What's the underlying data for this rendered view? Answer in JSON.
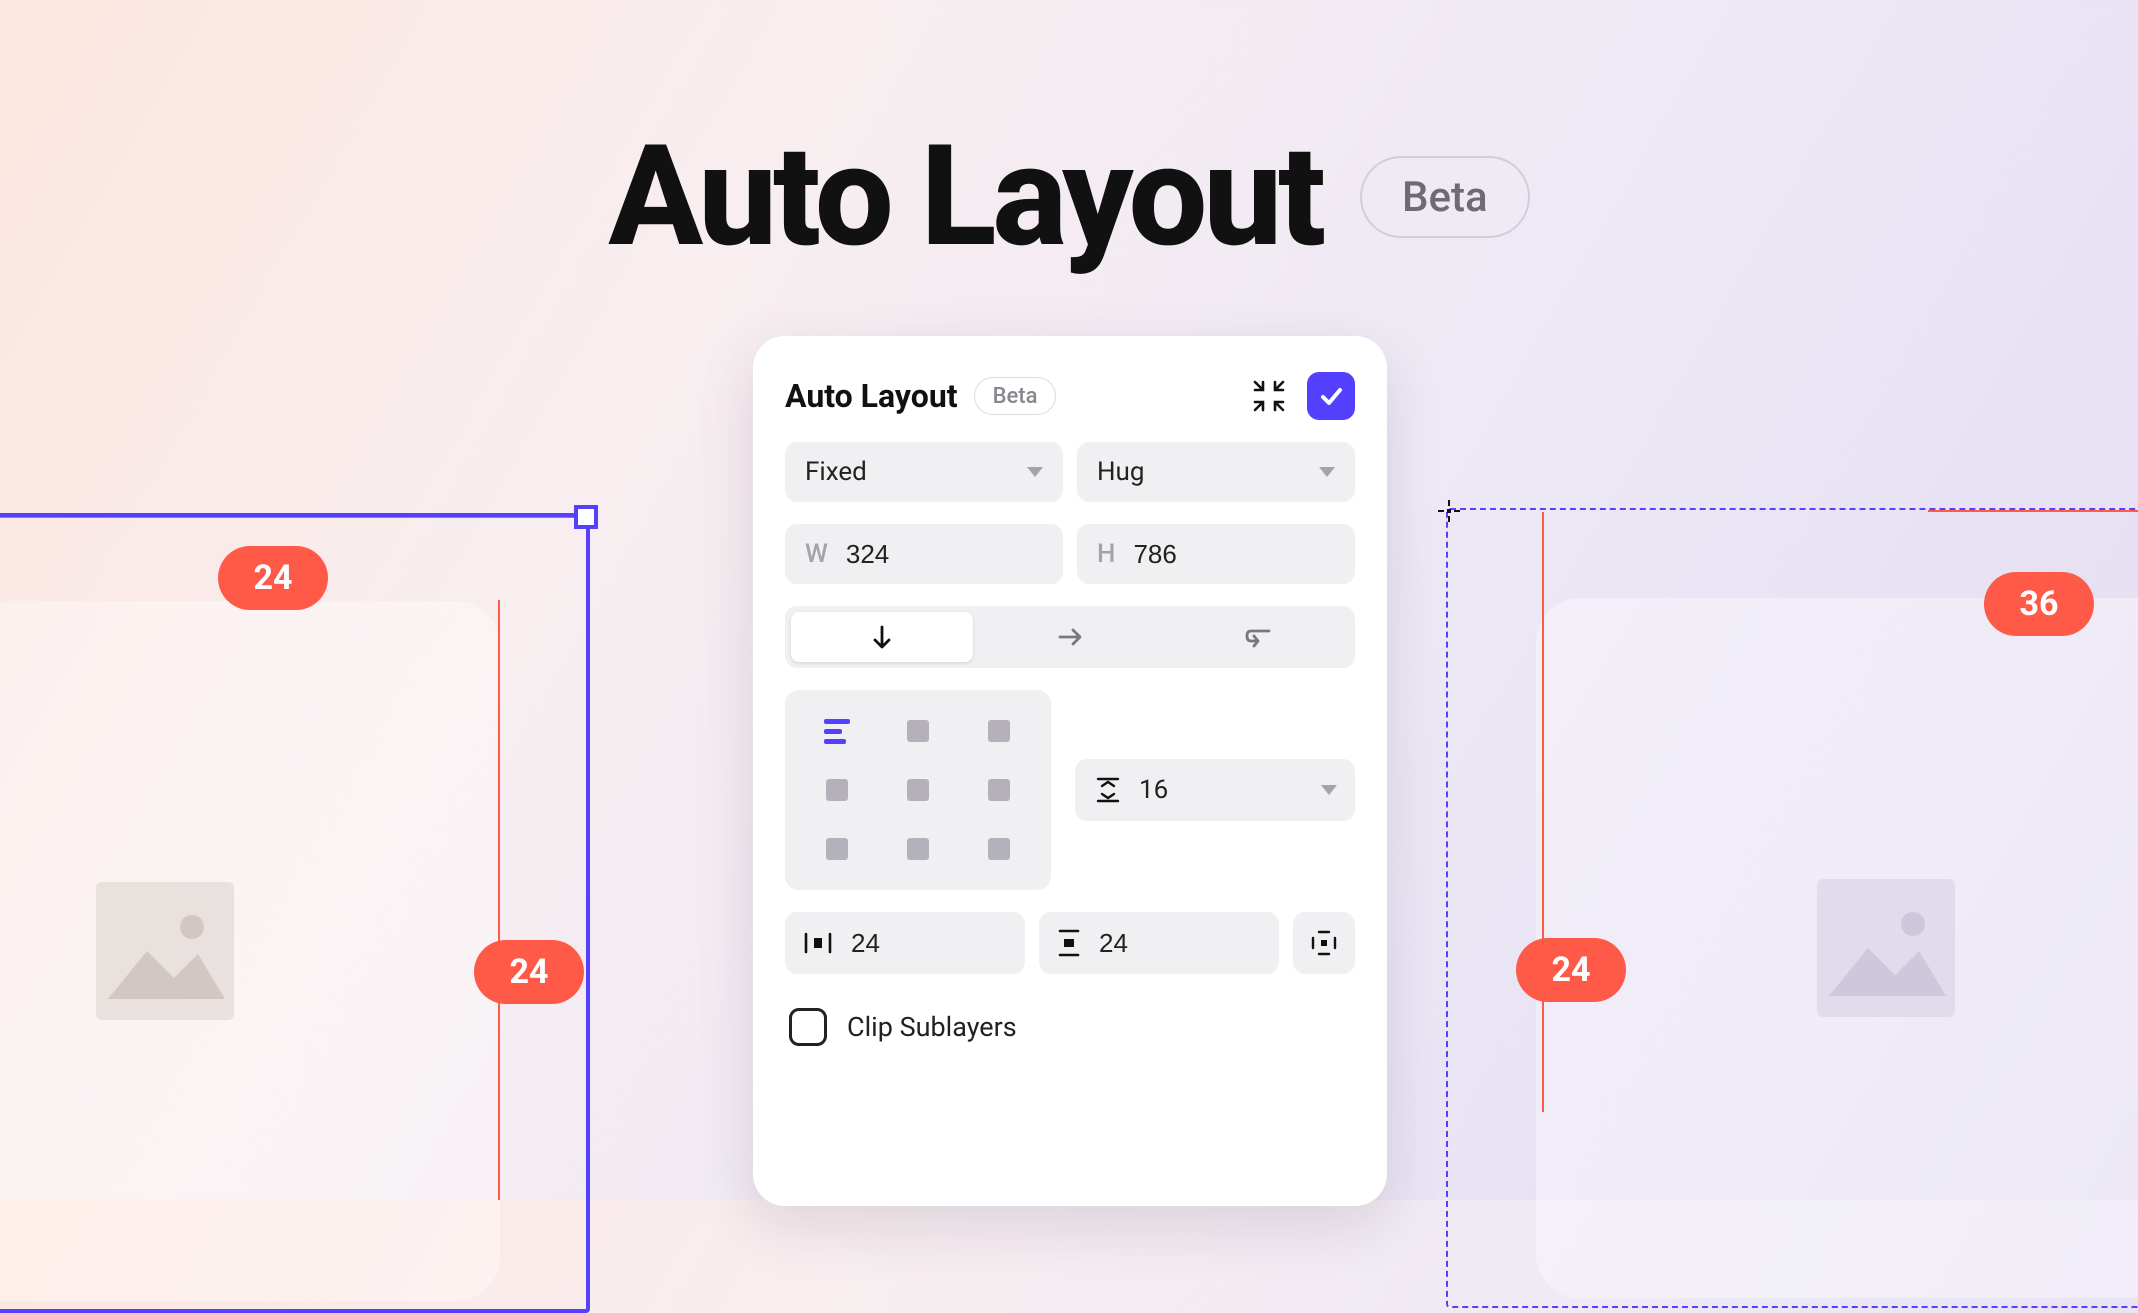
{
  "hero": {
    "title": "Auto Layout",
    "badge": "Beta"
  },
  "canvas": {
    "left": {
      "top_badge": "24",
      "bottom_badge": "24"
    },
    "right": {
      "top_badge": "36",
      "bottom_badge": "24"
    }
  },
  "panel": {
    "title": "Auto Layout",
    "badge": "Beta",
    "width_mode": "Fixed",
    "height_mode": "Hug",
    "width_label": "W",
    "width_value": "324",
    "height_label": "H",
    "height_value": "786",
    "gap_value": "16",
    "padding_h": "24",
    "padding_v": "24",
    "clip_label": "Clip Sublayers"
  }
}
